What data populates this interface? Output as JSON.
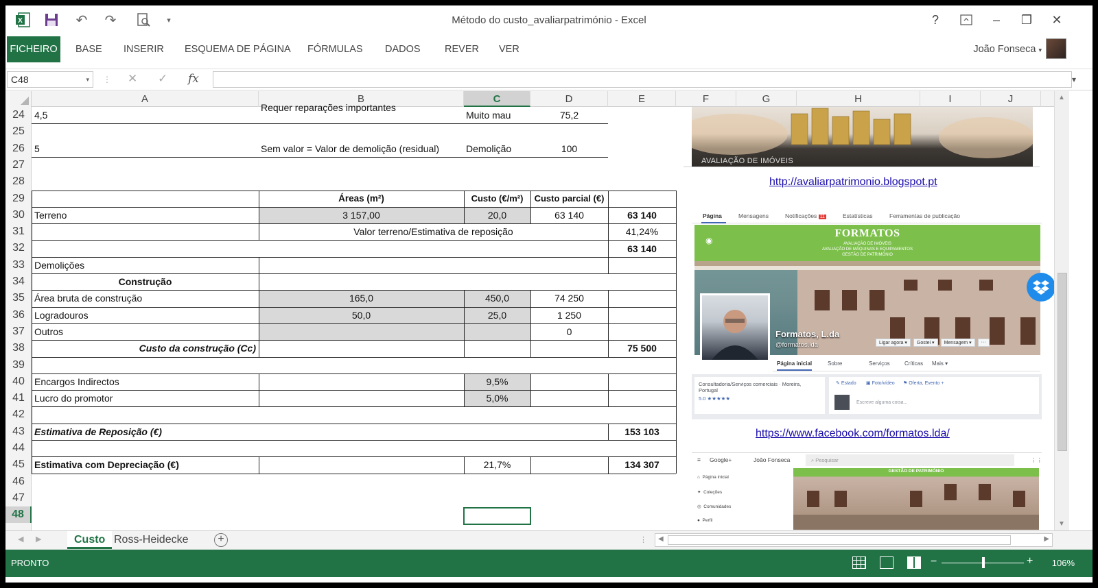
{
  "window": {
    "title": "Método do custo_avaliarpatrimónio - Excel"
  },
  "titlebar": {
    "help": "?",
    "minimize": "–",
    "restore": "❐",
    "close": "✕",
    "qat_more": "▾"
  },
  "ribbon": {
    "tabs": [
      "FICHEIRO",
      "BASE",
      "INSERIR",
      "ESQUEMA DE PÁGINA",
      "FÓRMULAS",
      "DADOS",
      "REVER",
      "VER"
    ],
    "user": "João Fonseca"
  },
  "formula_bar": {
    "name_box": "C48",
    "fx": "fx",
    "value": ""
  },
  "columns": [
    "A",
    "B",
    "C",
    "D",
    "E",
    "F",
    "G",
    "H",
    "I",
    "J"
  ],
  "selected_column": "C",
  "selected_row": "48",
  "rows": [
    "24",
    "25",
    "26",
    "27",
    "28",
    "29",
    "30",
    "31",
    "32",
    "33",
    "34",
    "35",
    "36",
    "37",
    "38",
    "39",
    "40",
    "41",
    "42",
    "43",
    "44",
    "45",
    "46",
    "47",
    "48"
  ],
  "sheet": {
    "r24_a": "4,5",
    "r24_b": "Requer reparações importantes",
    "r24_c": "Muito mau",
    "r24_d": "75,2",
    "r26_a": "5",
    "r26_b": "Sem valor = Valor de demolição (residual)",
    "r26_c": "Demolição",
    "r26_d": "100",
    "r29_b": "Áreas (m²)",
    "r29_c": "Custo (€/m²)",
    "r29_d": "Custo  parcial (€)",
    "r30_a": "Terreno",
    "r30_b": "3 157,00",
    "r30_c": "20,0",
    "r30_d": "63 140",
    "r30_e": "63 140",
    "r31_bd": "Valor terreno/Estimativa de reposição",
    "r31_e": "41,24%",
    "r32_e": "63 140",
    "r33_a": "Demolições",
    "r34_a": "Construção",
    "r35_a": "Área bruta de construção",
    "r35_b": "165,0",
    "r35_c": "450,0",
    "r35_d": "74 250",
    "r36_a": "Logradouros",
    "r36_b": "50,0",
    "r36_c": "25,0",
    "r36_d": "1 250",
    "r37_a": "Outros",
    "r37_d": "0",
    "r38_a": "Custo  da construção (Cc)",
    "r38_e": "75 500",
    "r40_a": "Encargos  Indirectos",
    "r40_c": "9,5%",
    "r41_a": "Lucro do promotor",
    "r41_c": "5,0%",
    "r43_a": "Estimativa de Reposição (€)",
    "r43_e": "153 103",
    "r45_a": "Estimativa com Depreciação (€)",
    "r45_c": "21,7%",
    "r45_e": "134 307"
  },
  "side_panel": {
    "banner_caption": "AVALIAÇÃO DE IMÓVEIS",
    "link1": "http://avaliarpatrimonio.blogspot.pt",
    "fb_tabs": [
      "Página",
      "Mensagens",
      "Notificações",
      "Estatísticas",
      "Ferramentas de publicação"
    ],
    "fb_notif_count": "11",
    "fb_brand": "FORMATOS",
    "fb_brand_lines": [
      "AVALIAÇÃO DE IMÓVEIS",
      "AVALIAÇÃO DE MÁQUINAS E EQUIPAMENTOS",
      "GESTÃO DE PATRIMÓNIO"
    ],
    "fb_name": "Formatos, L.da",
    "fb_handle": "@formatos.lda",
    "fb_buttons": [
      "Ligar agora ▾",
      "Gostei ▾",
      "Mensagem ▾",
      "···"
    ],
    "fb_nav": [
      "Página inicial",
      "Sobre",
      "Serviços",
      "Críticas",
      "Mais ▾"
    ],
    "fb_category": "Consultadoria/Serviços comerciais · Moreira, Portugal",
    "fb_rating": "5.0 ★★★★★",
    "fb_post_actions": [
      "Estado",
      "Foto/vídeo",
      "Oferta, Evento +"
    ],
    "fb_post_placeholder": "Escreve alguma coisa...",
    "link2": "https://www.facebook.com/formatos.lda/",
    "gplus_brand": "Google+",
    "gplus_user": "João Fonseca",
    "gplus_search": "Pesquisar",
    "gplus_banner": "GESTÃO DE PATRIMÓNIO",
    "gplus_nav": [
      "Página inicial",
      "Coleções",
      "Comunidades",
      "Perfil"
    ]
  },
  "sheet_tabs": [
    "Custo",
    "Ross-Heidecke"
  ],
  "status": {
    "ready": "PRONTO",
    "zoom": "106%"
  },
  "colors": {
    "excel_green": "#217346",
    "fb_green": "#7cc04b",
    "gray_fill": "#d9d9d9"
  }
}
